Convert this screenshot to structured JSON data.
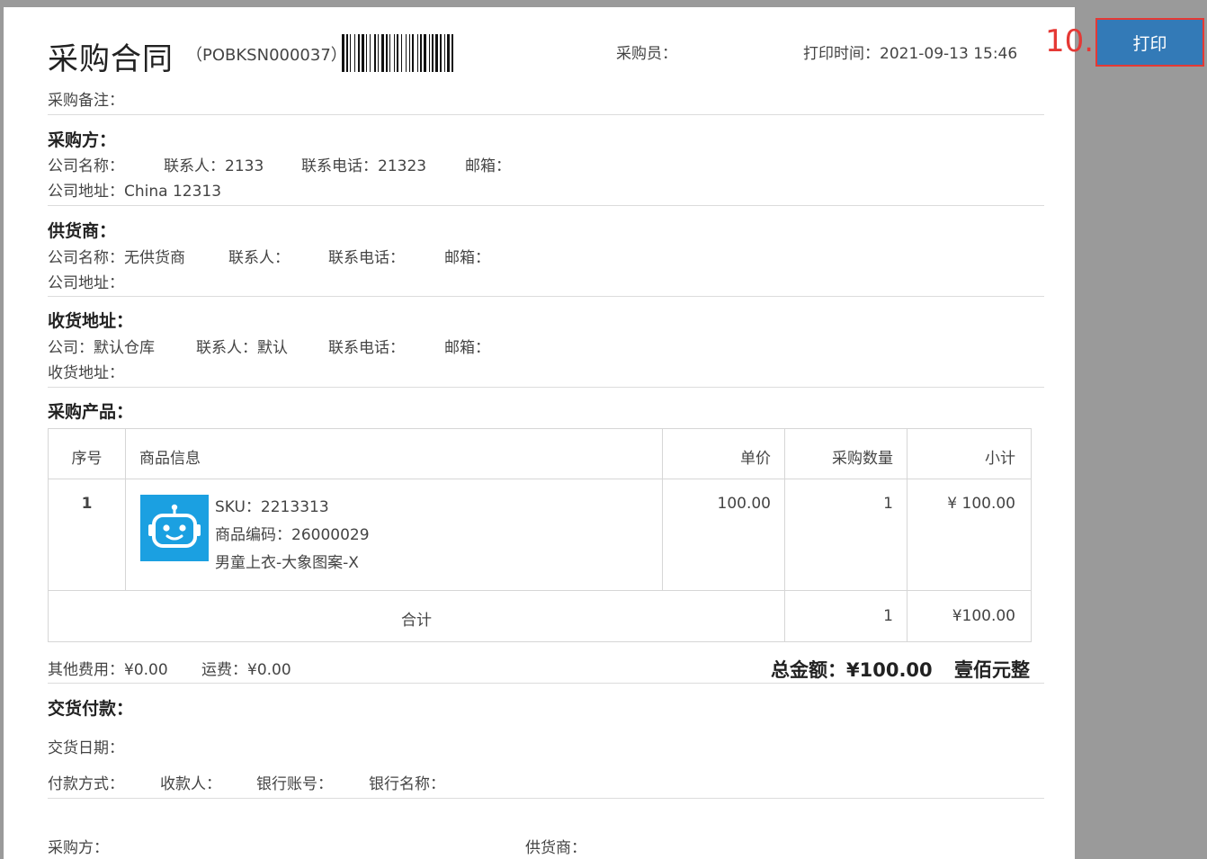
{
  "header": {
    "title": "采购合同",
    "order_no": "（POBKSN000037）",
    "buyer_label": "采购员：",
    "print_time_label": "打印时间：",
    "print_time": "2021-09-13 15:46",
    "note_label": "采购备注："
  },
  "purchaser": {
    "title": "采购方：",
    "company_label": "公司名称：",
    "contact_label": "联系人：",
    "contact": "2133",
    "phone_label": "联系电话：",
    "phone": "21323",
    "email_label": "邮箱：",
    "address_label": "公司地址：",
    "address": "China 12313"
  },
  "supplier": {
    "title": "供货商：",
    "company_label": "公司名称：",
    "company": "无供货商",
    "contact_label": "联系人：",
    "phone_label": "联系电话：",
    "email_label": "邮箱：",
    "address_label": "公司地址："
  },
  "delivery": {
    "title": "收货地址：",
    "company_label": "公司：",
    "company": "默认仓库",
    "contact_label": "联系人：",
    "contact": "默认",
    "phone_label": "联系电话：",
    "email_label": "邮箱：",
    "address_label": "收货地址："
  },
  "products": {
    "title": "采购产品：",
    "columns": [
      "序号",
      "商品信息",
      "单价",
      "采购数量",
      "小计"
    ],
    "rows": [
      {
        "index": "1",
        "sku": "SKU：2213313",
        "code": "商品编码：26000029",
        "name": "男童上衣-大象图案-X",
        "price": "100.00",
        "qty": "1",
        "subtotal": "¥ 100.00"
      }
    ],
    "total_label": "合计",
    "total_qty": "1",
    "total_amount": "¥100.00"
  },
  "fees": {
    "other_label": "其他费用：",
    "other": "¥0.00",
    "freight_label": "运费：",
    "freight": "¥0.00",
    "grand_total_label": "总金额：",
    "grand_total": "¥100.00",
    "grand_total_words": "壹佰元整"
  },
  "payment": {
    "title": "交货付款：",
    "delivery_date_label": "交货日期：",
    "method_label": "付款方式：",
    "payee_label": "收款人：",
    "account_label": "银行账号：",
    "bank_label": "银行名称："
  },
  "signature": {
    "purchaser_label": "采购方：",
    "supplier_label": "供货商："
  },
  "actions": {
    "step": "10.",
    "print_label": "打印"
  },
  "colors": {
    "print_button": "#337ab7",
    "highlight": "#e53935",
    "product_image": "#1ba0e1"
  }
}
